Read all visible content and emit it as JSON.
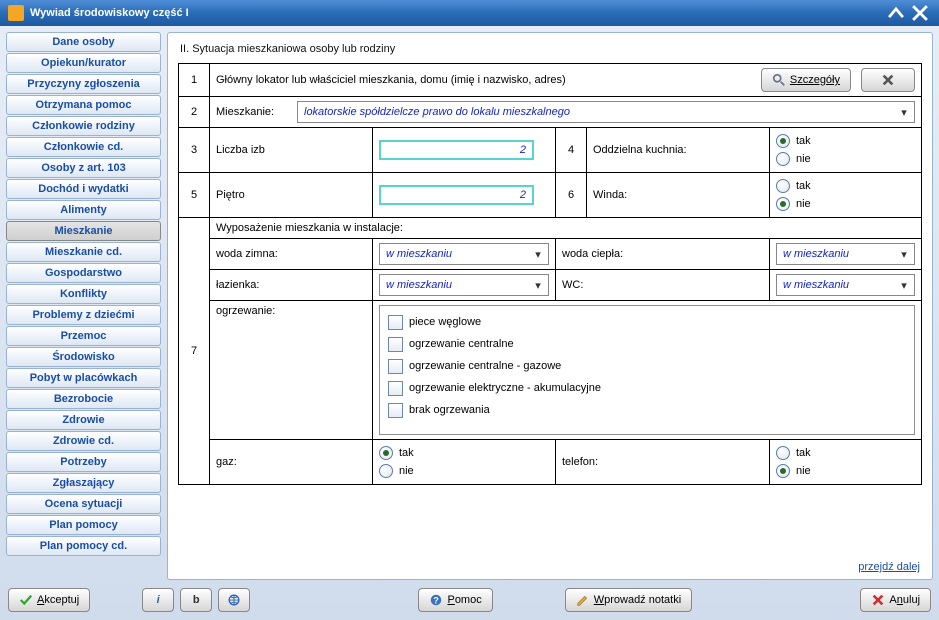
{
  "title": "Wywiad środowiskowy część I",
  "sidebar": {
    "items": [
      {
        "label": "Dane osoby"
      },
      {
        "label": "Opiekun/kurator"
      },
      {
        "label": "Przyczyny zgłoszenia"
      },
      {
        "label": "Otrzymana pomoc"
      },
      {
        "label": "Członkowie rodziny"
      },
      {
        "label": "Członkowie cd."
      },
      {
        "label": "Osoby z art. 103"
      },
      {
        "label": "Dochód i wydatki"
      },
      {
        "label": "Alimenty"
      },
      {
        "label": "Mieszkanie"
      },
      {
        "label": "Mieszkanie cd."
      },
      {
        "label": "Gospodarstwo"
      },
      {
        "label": "Konflikty"
      },
      {
        "label": "Problemy z dziećmi"
      },
      {
        "label": "Przemoc"
      },
      {
        "label": "Środowisko"
      },
      {
        "label": "Pobyt w placówkach"
      },
      {
        "label": "Bezrobocie"
      },
      {
        "label": "Zdrowie"
      },
      {
        "label": "Zdrowie cd."
      },
      {
        "label": "Potrzeby"
      },
      {
        "label": "Zgłaszający"
      },
      {
        "label": "Ocena sytuacji"
      },
      {
        "label": "Plan pomocy"
      },
      {
        "label": "Plan pomocy cd."
      }
    ],
    "active_index": 9
  },
  "section": {
    "title": "II. Sytuacja mieszkaniowa osoby lub rodziny",
    "row1": {
      "num": "1",
      "desc": "Główny lokator lub właściciel mieszkania, domu (imię i nazwisko, adres)",
      "details_btn": "Szczegóły"
    },
    "row2": {
      "num": "2",
      "label": "Mieszkanie:",
      "value": "lokatorskie spółdzielcze prawo do lokalu mieszkalnego"
    },
    "row3": {
      "num": "3",
      "label": "Liczba izb",
      "value": "2",
      "num_b": "4",
      "label_b": "Oddzielna kuchnia:",
      "opt_yes": "tak",
      "opt_no": "nie",
      "sel_yes": true
    },
    "row5": {
      "num": "5",
      "label": "Piętro",
      "value": "2",
      "num_b": "6",
      "label_b": "Winda:",
      "opt_yes": "tak",
      "opt_no": "nie",
      "sel_no": true
    },
    "row7": {
      "num": "7",
      "title": "Wyposażenie mieszkania w instalacje:",
      "cold_label": "woda zimna:",
      "cold_value": "w mieszkaniu",
      "hot_label": "woda ciepła:",
      "hot_value": "w mieszkaniu",
      "bath_label": "łazienka:",
      "bath_value": "w mieszkaniu",
      "wc_label": "WC:",
      "wc_value": "w mieszkaniu",
      "heating_label": "ogrzewanie:",
      "heating_options": [
        "piece węglowe",
        "ogrzewanie centralne",
        "ogrzewanie centralne - gazowe",
        "ogrzewanie elektryczne - akumulacyjne",
        "brak ogrzewania"
      ],
      "gas_label": "gaz:",
      "gas_yes": "tak",
      "gas_no": "nie",
      "gas_sel_yes": true,
      "tel_label": "telefon:",
      "tel_yes": "tak",
      "tel_no": "nie",
      "tel_sel_no": true
    },
    "next_link": "przejdź dalej"
  },
  "footer": {
    "accept": "Akceptuj",
    "info": "i",
    "bold": "b",
    "globe": "",
    "help": "Pomoc",
    "notes": "Wprowadź notatki",
    "cancel": "Anuluj"
  }
}
